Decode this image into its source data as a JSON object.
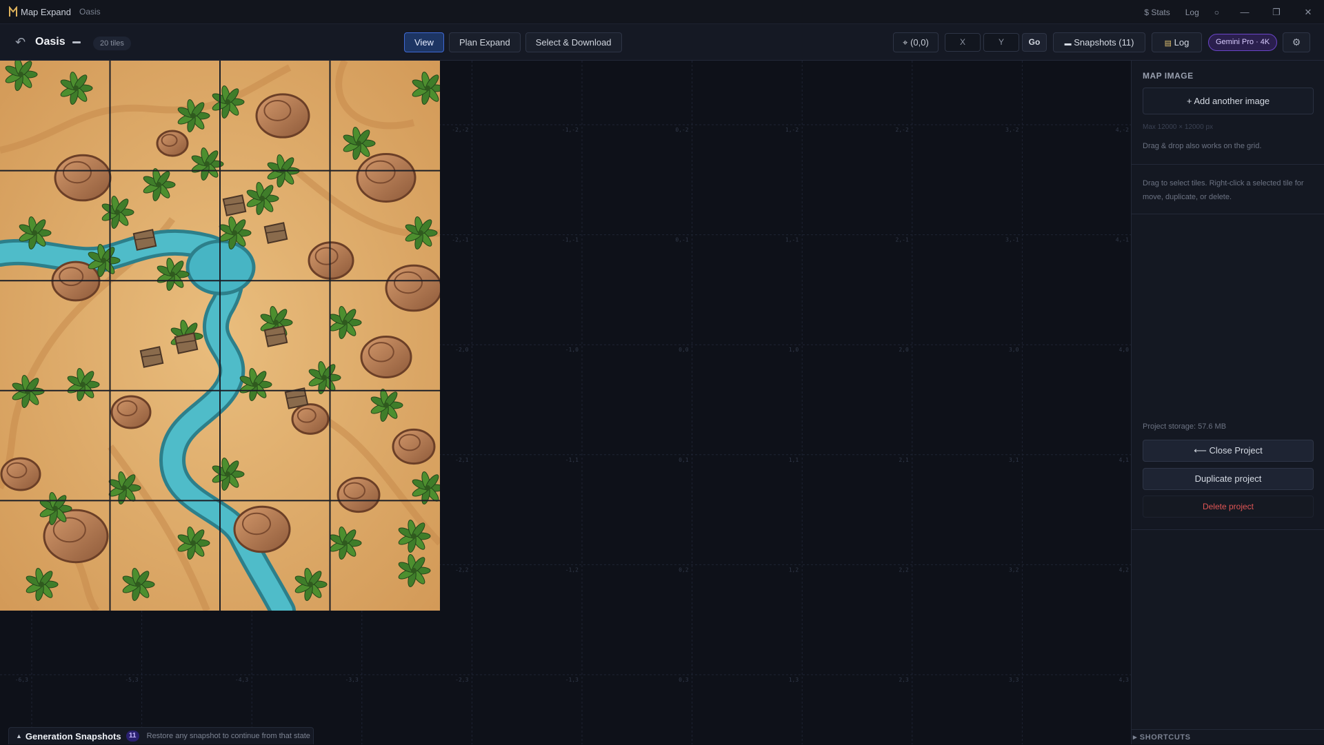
{
  "titlebar": {
    "app_name": "Map Expand",
    "project_name": "Oasis",
    "stats_link": "$ Stats",
    "log_link": "Log",
    "help_icon": "circle-icon",
    "minimize": "—",
    "maximize": "❐",
    "close": "✕"
  },
  "toolbar": {
    "back_icon": "undo-arrow-icon",
    "project_title": "Oasis",
    "tiles_badge": "20 tiles",
    "modes": [
      "View",
      "Plan Expand",
      "Select & Download"
    ],
    "active_mode": "View",
    "coord_label": "⌖ (0,0)",
    "x_placeholder": "X",
    "y_placeholder": "Y",
    "go_label": "Go",
    "snapshots_label": "Snapshots (11)",
    "log_label": "Log",
    "model_badge": "Gemini Pro · 4K",
    "settings_icon": "gear-icon"
  },
  "grid": {
    "column_labels": [
      "-6",
      "-5",
      "-4",
      "-3",
      "-2",
      "-1",
      "0",
      "1",
      "2",
      "3",
      "4"
    ],
    "row_labels": [
      "-2",
      "-1",
      "0",
      "1",
      "2",
      "3"
    ],
    "map_cols": 4,
    "map_rows": 5,
    "colors": {
      "background": "#0e1119",
      "grid_line": "#1e2434",
      "label": "#323a4b",
      "sand": "#e0ae6c",
      "water": "#48b3c4",
      "foliage": "#3f7d2a",
      "rock": "#b87c52"
    }
  },
  "sidebar": {
    "section_title": "MAP IMAGE",
    "add_image": "+ Add another image",
    "max_size_hint": "Max 12000 × 12000 px",
    "drag_drop_hint": "Drag & drop also works on the grid.",
    "select_hint": "Drag to select tiles. Right-click a selected tile for move, duplicate, or delete.",
    "storage": "Project storage: 57.6 MB",
    "close_project": "⟵ Close Project",
    "duplicate_project": "Duplicate project",
    "delete_project": "Delete project",
    "shortcuts": "▸ SHORTCUTS"
  },
  "snapshots_bar": {
    "caret": "▲",
    "title": "Generation Snapshots",
    "count": "11",
    "description": "Restore any snapshot to continue from that state"
  }
}
